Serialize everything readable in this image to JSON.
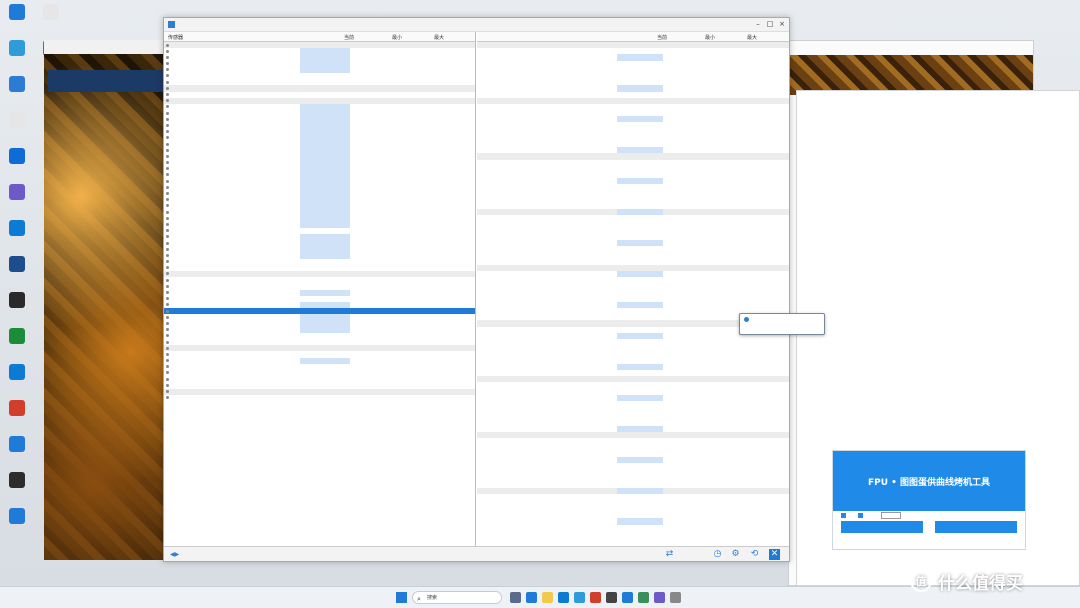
{
  "desktop": {
    "icons": [
      {
        "label": "",
        "color": "#1f7ad8"
      },
      {
        "label": "",
        "color": "#2f9bd8"
      },
      {
        "label": "",
        "color": "#2c7bd4"
      },
      {
        "label": "",
        "color": "#e6e6e6"
      },
      {
        "label": "",
        "color": "#0f6bd6"
      },
      {
        "label": "",
        "color": "#6e59c9"
      },
      {
        "label": "",
        "color": "#0b7bd3"
      },
      {
        "label": "",
        "color": "#1d4c8f"
      },
      {
        "label": "",
        "color": "#2a2a2a"
      },
      {
        "label": "",
        "color": "#1b8c3a"
      },
      {
        "label": "",
        "color": "#0b7bd3"
      },
      {
        "label": "",
        "color": "#d13f2c"
      },
      {
        "label": "",
        "color": "#1f7ad8"
      },
      {
        "label": "",
        "color": "#2c2c2c"
      },
      {
        "label": "",
        "color": "#1f7ad8"
      },
      {
        "label": "",
        "color": "#e6e6e6"
      },
      {
        "label": "",
        "color": "#1f7ad8"
      }
    ]
  },
  "art_window": {
    "title": "",
    "banner": ""
  },
  "hwinfo": {
    "title": "",
    "left_headers": {
      "sensor": "传感器",
      "current": "当前",
      "min": "最小",
      "max": "最大"
    },
    "right_headers": {
      "sensor": "",
      "current": "当前",
      "min": "最小",
      "max": "最大"
    },
    "left_rows": [
      {
        "type": "group",
        "name": ""
      },
      {
        "type": "row",
        "name": "",
        "hl": 1
      },
      {
        "type": "row",
        "name": "",
        "hl": 1
      },
      {
        "type": "row",
        "name": "",
        "hl": 1
      },
      {
        "type": "row",
        "name": "",
        "hl": 1
      },
      {
        "type": "row",
        "name": "",
        "hl": 0
      },
      {
        "type": "row",
        "name": "",
        "hl": 0
      },
      {
        "type": "group",
        "name": ""
      },
      {
        "type": "row",
        "name": "",
        "hl": 0
      },
      {
        "type": "group",
        "name": ""
      },
      {
        "type": "row",
        "name": "",
        "hl": 1
      },
      {
        "type": "row",
        "name": "",
        "hl": 1
      },
      {
        "type": "row",
        "name": "",
        "hl": 1
      },
      {
        "type": "row",
        "name": "",
        "hl": 1
      },
      {
        "type": "row",
        "name": "",
        "hl": 1
      },
      {
        "type": "row",
        "name": "",
        "hl": 1
      },
      {
        "type": "row",
        "name": "",
        "hl": 1
      },
      {
        "type": "row",
        "name": "",
        "hl": 1
      },
      {
        "type": "row",
        "name": "",
        "hl": 1
      },
      {
        "type": "row",
        "name": "",
        "hl": 1
      },
      {
        "type": "row",
        "name": "",
        "hl": 1
      },
      {
        "type": "row",
        "name": "",
        "hl": 1
      },
      {
        "type": "row",
        "name": "",
        "hl": 1
      },
      {
        "type": "row",
        "name": "",
        "hl": 1
      },
      {
        "type": "row",
        "name": "",
        "hl": 1
      },
      {
        "type": "row",
        "name": "",
        "hl": 1
      },
      {
        "type": "row",
        "name": "",
        "hl": 1
      },
      {
        "type": "row",
        "name": "",
        "hl": 1
      },
      {
        "type": "row",
        "name": "",
        "hl": 1
      },
      {
        "type": "row",
        "name": "",
        "hl": 1
      },
      {
        "type": "row",
        "name": "",
        "hl": 0
      },
      {
        "type": "row",
        "name": "",
        "hl": 1
      },
      {
        "type": "row",
        "name": "",
        "hl": 1
      },
      {
        "type": "row",
        "name": "",
        "hl": 1
      },
      {
        "type": "row",
        "name": "",
        "hl": 1
      },
      {
        "type": "row",
        "name": "",
        "hl": 0
      },
      {
        "type": "row",
        "name": "",
        "hl": 0
      },
      {
        "type": "group",
        "name": ""
      },
      {
        "type": "row",
        "name": "",
        "hl": 0
      },
      {
        "type": "row",
        "name": "",
        "hl": 0
      },
      {
        "type": "row",
        "name": "",
        "hl": 1
      },
      {
        "type": "row",
        "name": "",
        "hl": 0
      },
      {
        "type": "row",
        "name": "",
        "hl": 1
      },
      {
        "type": "row",
        "name": "",
        "hl": 0,
        "sel": true
      },
      {
        "type": "row",
        "name": "",
        "hl": 1
      },
      {
        "type": "row",
        "name": "",
        "hl": 1
      },
      {
        "type": "row",
        "name": "",
        "hl": 1
      },
      {
        "type": "row",
        "name": "",
        "hl": 0
      },
      {
        "type": "row",
        "name": "",
        "hl": 0
      },
      {
        "type": "group",
        "name": ""
      },
      {
        "type": "row",
        "name": "",
        "hl": 0
      },
      {
        "type": "row",
        "name": "",
        "hl": 1
      },
      {
        "type": "row",
        "name": "",
        "hl": 0
      },
      {
        "type": "row",
        "name": "",
        "hl": 0
      },
      {
        "type": "row",
        "name": "",
        "hl": 0
      },
      {
        "type": "row",
        "name": "",
        "hl": 0
      },
      {
        "type": "group",
        "name": ""
      },
      {
        "type": "row",
        "name": "",
        "hl": 0
      }
    ],
    "right_rows_count": 80,
    "status": {
      "time": ""
    }
  },
  "tooltip": {
    "text": ""
  },
  "fpu_popup": {
    "header": "FPU • 图图蛋供曲线烤机工具",
    "option_a": "",
    "option_b": "",
    "input_label": "",
    "btn_left": "",
    "btn_right": ""
  },
  "bg_window": {
    "stray_text": ""
  },
  "taskbar": {
    "weather": "",
    "search_placeholder": "搜索",
    "tray_time": "",
    "tray_date": ""
  },
  "watermark": {
    "text": "什么值得买"
  },
  "colors": {
    "accent": "#1f7ad8",
    "highlight": "#cfe2f8",
    "group_bg": "#ececec"
  }
}
